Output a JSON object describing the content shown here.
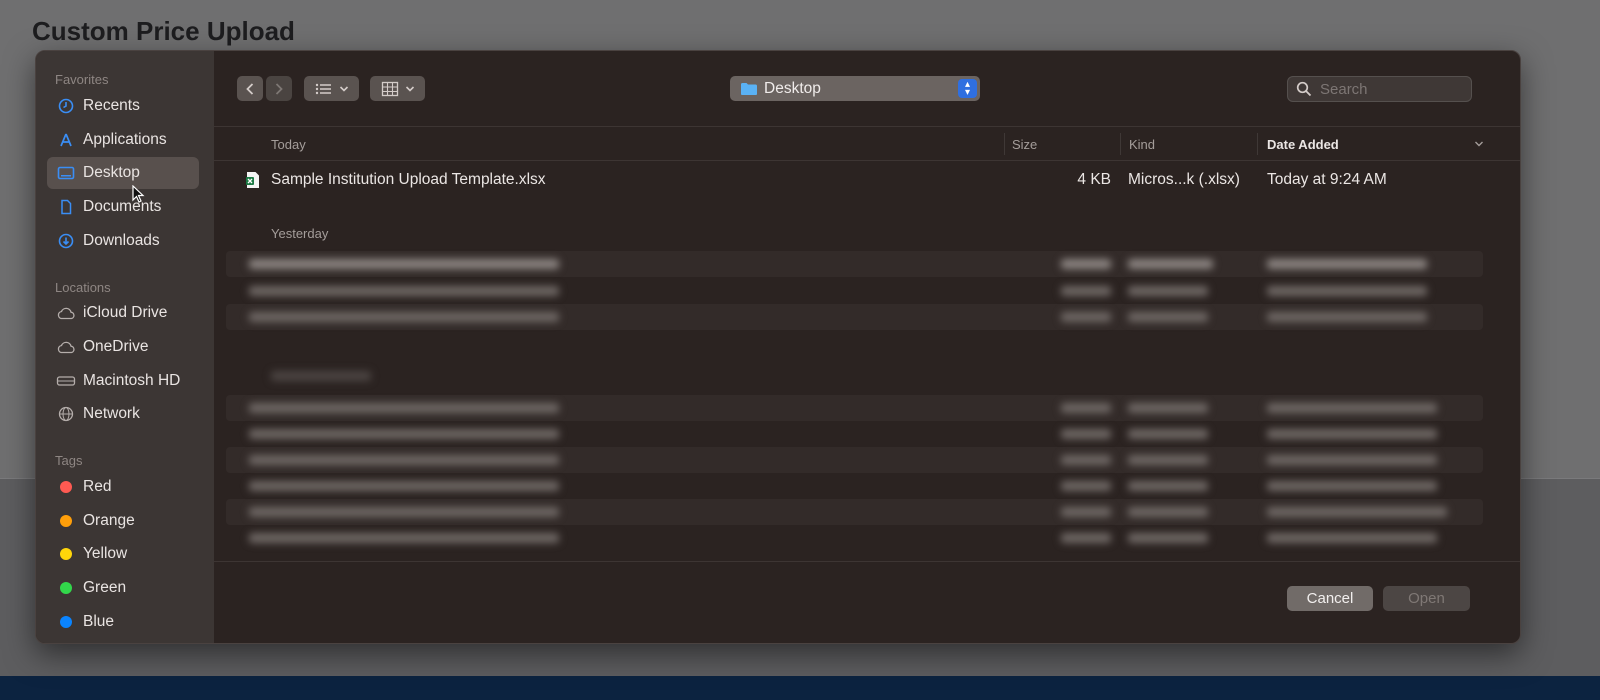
{
  "page": {
    "title": "Custom Price Upload"
  },
  "sidebar": {
    "favorites_label": "Favorites",
    "favorites": [
      {
        "label": "Recents",
        "icon": "clock-icon"
      },
      {
        "label": "Applications",
        "icon": "applications-icon"
      },
      {
        "label": "Desktop",
        "icon": "desktop-icon",
        "selected": true
      },
      {
        "label": "Documents",
        "icon": "document-icon"
      },
      {
        "label": "Downloads",
        "icon": "download-icon"
      }
    ],
    "locations_label": "Locations",
    "locations": [
      {
        "label": "iCloud Drive",
        "icon": "cloud-icon"
      },
      {
        "label": "OneDrive",
        "icon": "cloud-icon"
      },
      {
        "label": "Macintosh HD",
        "icon": "disk-icon"
      },
      {
        "label": "Network",
        "icon": "globe-icon"
      }
    ],
    "tags_label": "Tags",
    "tags": [
      {
        "label": "Red",
        "color": "#ff5a52"
      },
      {
        "label": "Orange",
        "color": "#ff9f0a"
      },
      {
        "label": "Yellow",
        "color": "#ffd60a"
      },
      {
        "label": "Green",
        "color": "#32d74b"
      },
      {
        "label": "Blue",
        "color": "#0a84ff"
      }
    ]
  },
  "toolbar": {
    "current_folder": "Desktop",
    "search_placeholder": "Search"
  },
  "columns": {
    "name": "Today",
    "size": "Size",
    "kind": "Kind",
    "date_added": "Date Added"
  },
  "groups": {
    "today": {
      "label": "Today",
      "files": [
        {
          "name": "Sample Institution Upload Template.xlsx",
          "size": "4 KB",
          "kind": "Micros...k (.xlsx)",
          "date": "Today at 9:24 AM"
        }
      ]
    },
    "yesterday": {
      "label": "Yesterday"
    }
  },
  "buttons": {
    "cancel": "Cancel",
    "open": "Open"
  }
}
